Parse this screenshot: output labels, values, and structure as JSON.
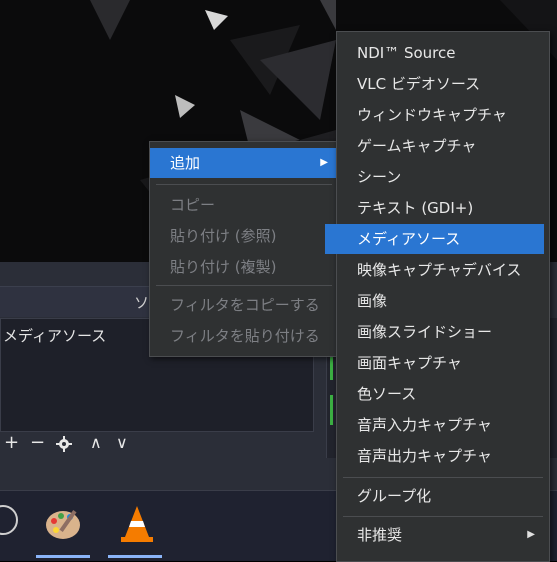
{
  "dock": {
    "title": "ソ",
    "source_item": "メディアソース"
  },
  "toolbar": {
    "add": "+",
    "remove": "−",
    "up": "∧",
    "down": "∨"
  },
  "context_menu": {
    "add": "追加",
    "copy": "コピー",
    "paste_ref": "貼り付け (参照)",
    "paste_dup": "貼り付け (複製)",
    "copy_filters": "フィルタをコピーする",
    "paste_filters": "フィルタを貼り付ける"
  },
  "submenu": {
    "items": [
      "NDI™ Source",
      "VLC ビデオソース",
      "ウィンドウキャプチャ",
      "ゲームキャプチャ",
      "シーン",
      "テキスト (GDI+)",
      "メディアソース",
      "映像キャプチャデバイス",
      "画像",
      "画像スライドショー",
      "画面キャプチャ",
      "色ソース",
      "音声入力キャプチャ",
      "音声出力キャプチャ"
    ],
    "group": "グループ化",
    "deprecated": "非推奨",
    "highlighted_index": 6
  },
  "colors": {
    "highlight": "#2a76d2",
    "menu_bg": "#2f3132"
  }
}
